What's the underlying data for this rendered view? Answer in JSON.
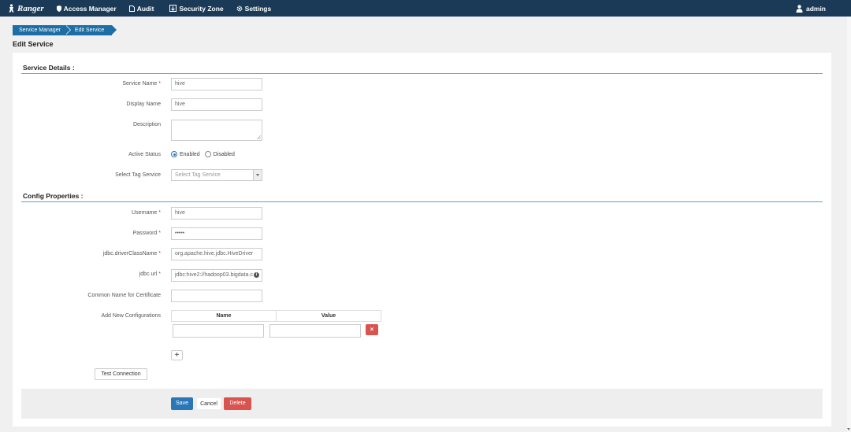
{
  "navbar": {
    "brand": "Ranger",
    "items": [
      {
        "label": "Access Manager",
        "icon": "shield-icon"
      },
      {
        "label": "Audit",
        "icon": "file-icon"
      },
      {
        "label": "Security Zone",
        "icon": "zone-icon"
      },
      {
        "label": "Settings",
        "icon": "gear-icon"
      }
    ],
    "user": "admin"
  },
  "breadcrumb": [
    "Service Manager",
    "Edit Service"
  ],
  "page_title": "Edit Service",
  "service_details": {
    "title": "Service Details :",
    "service_name": {
      "label": "Service Name",
      "value": "hive"
    },
    "display_name": {
      "label": "Display Name",
      "value": "hive"
    },
    "description": {
      "label": "Description",
      "value": ""
    },
    "active_status": {
      "label": "Active Status",
      "options": [
        "Enabled",
        "Disabled"
      ],
      "selected": "Enabled"
    },
    "tag_service": {
      "label": "Select Tag Service",
      "placeholder": "Select Tag Service"
    }
  },
  "config_properties": {
    "title": "Config Properties :",
    "username": {
      "label": "Username",
      "value": "hive"
    },
    "password": {
      "label": "Password",
      "value": "•••••"
    },
    "driver": {
      "label": "jdbc.driverClassName",
      "value": "org.apache.hive.jdbc.HiveDriver"
    },
    "url": {
      "label": "jdbc.url",
      "value": "jdbc:hive2://hadoop03.bigdata.c"
    },
    "common_name": {
      "label": "Common Name for Certificate",
      "value": ""
    },
    "add_new": {
      "label": "Add New Configurations",
      "columns": [
        "Name",
        "Value"
      ]
    }
  },
  "buttons": {
    "test_connection": "Test Connection",
    "save": "Save",
    "cancel": "Cancel",
    "delete": "Delete",
    "add": "+",
    "remove": "×"
  },
  "colors": {
    "navbar": "#1b3a57",
    "primary": "#2a77b8",
    "danger": "#d9534f",
    "accent_line": "#5aa3d6"
  }
}
